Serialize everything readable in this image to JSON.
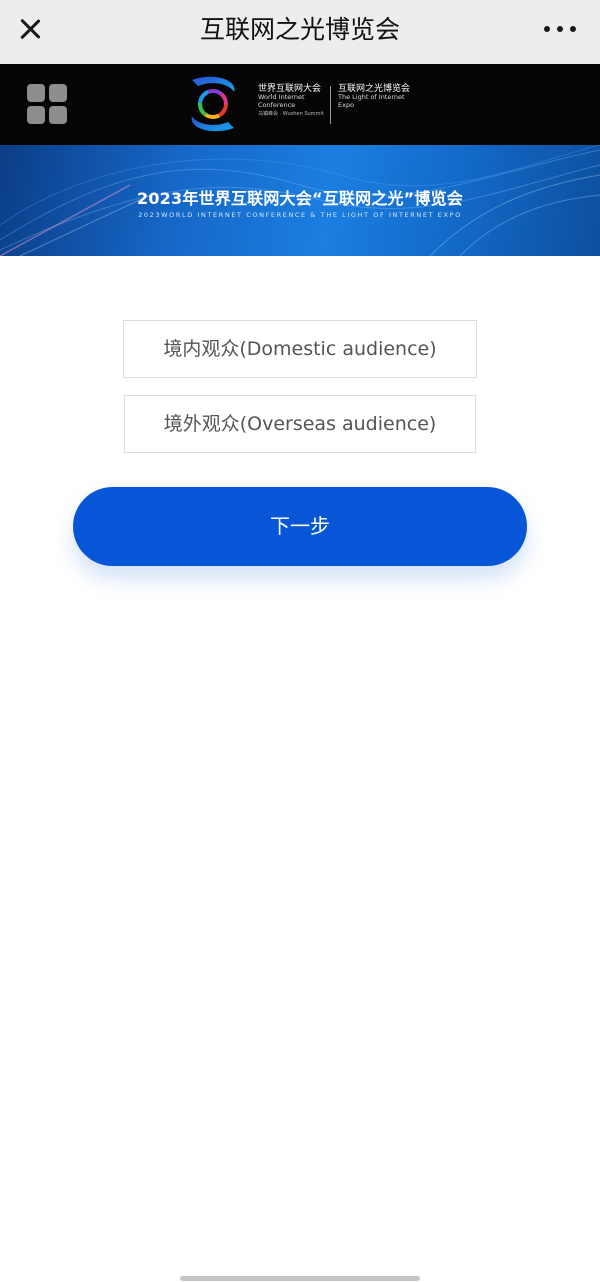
{
  "topbar": {
    "title": "互联网之光博览会",
    "close_icon": "close-icon",
    "more_icon": "more-dots-icon"
  },
  "header": {
    "menu_icon": "grid-menu-icon",
    "logo_icon": "wic-logo-icon",
    "logo_cn": "世界互联网大会",
    "logo_en_line1": "World  Internet",
    "logo_en_line2": "Conference",
    "logo_sub": "乌镇峰会 · Wuzhen Summit",
    "expo_cn": "互联网之光博览会",
    "expo_en_line1": "The Light of Internet",
    "expo_en_line2": "Expo"
  },
  "banner": {
    "title": "2023年世界互联网大会“互联网之光”博览会",
    "subtitle": "2023WORLD INTERNET CONFERENCE & THE LIGHT OF INTERNET EXPO"
  },
  "options": {
    "domestic": "境内观众(Domestic audience)",
    "overseas": "境外观众(Overseas audience)"
  },
  "actions": {
    "next_label": "下一步"
  },
  "colors": {
    "topbar_bg": "#ededed",
    "header_bg": "#050505",
    "accent": "#0856d8",
    "banner_blue": "#1668c8"
  }
}
